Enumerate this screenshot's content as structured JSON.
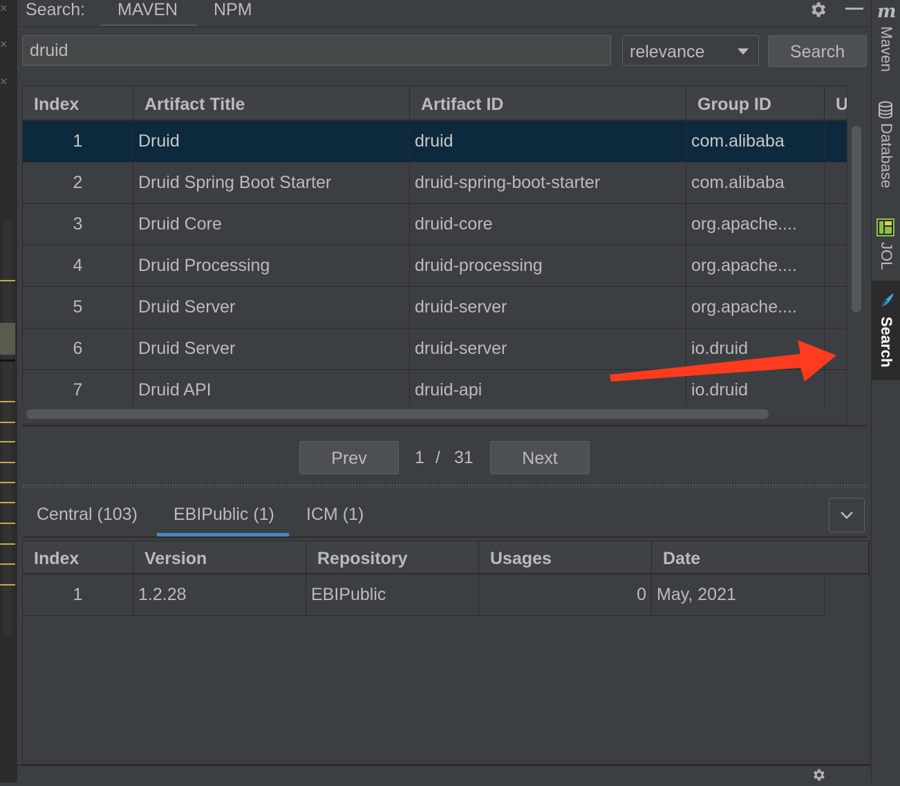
{
  "header": {
    "label": "Search:",
    "tabs": [
      {
        "label": "MAVEN",
        "active": true
      },
      {
        "label": "NPM",
        "active": false
      }
    ],
    "settings_icon": "gear-icon",
    "minimize_icon": "minimize-icon"
  },
  "search": {
    "query": "druid",
    "sort": "relevance",
    "button_label": "Search"
  },
  "results": {
    "columns": [
      "Index",
      "Artifact Title",
      "Artifact ID",
      "Group ID",
      "U"
    ],
    "rows": [
      {
        "index": "1",
        "title": "Druid",
        "artifact_id": "druid",
        "group_id": "com.alibaba"
      },
      {
        "index": "2",
        "title": "Druid Spring Boot Starter",
        "artifact_id": "druid-spring-boot-starter",
        "group_id": "com.alibaba"
      },
      {
        "index": "3",
        "title": "Druid Core",
        "artifact_id": "druid-core",
        "group_id": "org.apache...."
      },
      {
        "index": "4",
        "title": "Druid Processing",
        "artifact_id": "druid-processing",
        "group_id": "org.apache...."
      },
      {
        "index": "5",
        "title": "Druid Server",
        "artifact_id": "druid-server",
        "group_id": "org.apache...."
      },
      {
        "index": "6",
        "title": "Druid Server",
        "artifact_id": "druid-server",
        "group_id": "io.druid"
      },
      {
        "index": "7",
        "title": "Druid API",
        "artifact_id": "druid-api",
        "group_id": "io.druid"
      }
    ],
    "selected_row": 1
  },
  "pagination": {
    "prev_label": "Prev",
    "current": "1",
    "separator": "/",
    "total": "31",
    "next_label": "Next"
  },
  "repositories": {
    "tabs": [
      {
        "label": "Central (103)",
        "active": false
      },
      {
        "label": "EBIPublic (1)",
        "active": true
      },
      {
        "label": "ICM (1)",
        "active": false
      }
    ],
    "dropdown_icon": "chevron-down-icon"
  },
  "versions": {
    "columns": [
      "Index",
      "Version",
      "Repository",
      "Usages",
      "Date"
    ],
    "rows": [
      {
        "index": "1",
        "version": "1.2.28",
        "repository": "EBIPublic",
        "usages": "0",
        "date": "May, 2021"
      }
    ]
  },
  "tool_strip": {
    "items": [
      {
        "label": "Maven",
        "icon": "maven-icon"
      },
      {
        "label": "Database",
        "icon": "database-icon"
      },
      {
        "label": "JOL",
        "icon": "jol-icon"
      },
      {
        "label": "Search",
        "icon": "feather-icon",
        "active": true
      }
    ]
  },
  "colors": {
    "background": "#3c3f41",
    "selection": "#0d293e",
    "accent": "#4a88c7",
    "annotation_arrow": "#ff3b1f"
  }
}
